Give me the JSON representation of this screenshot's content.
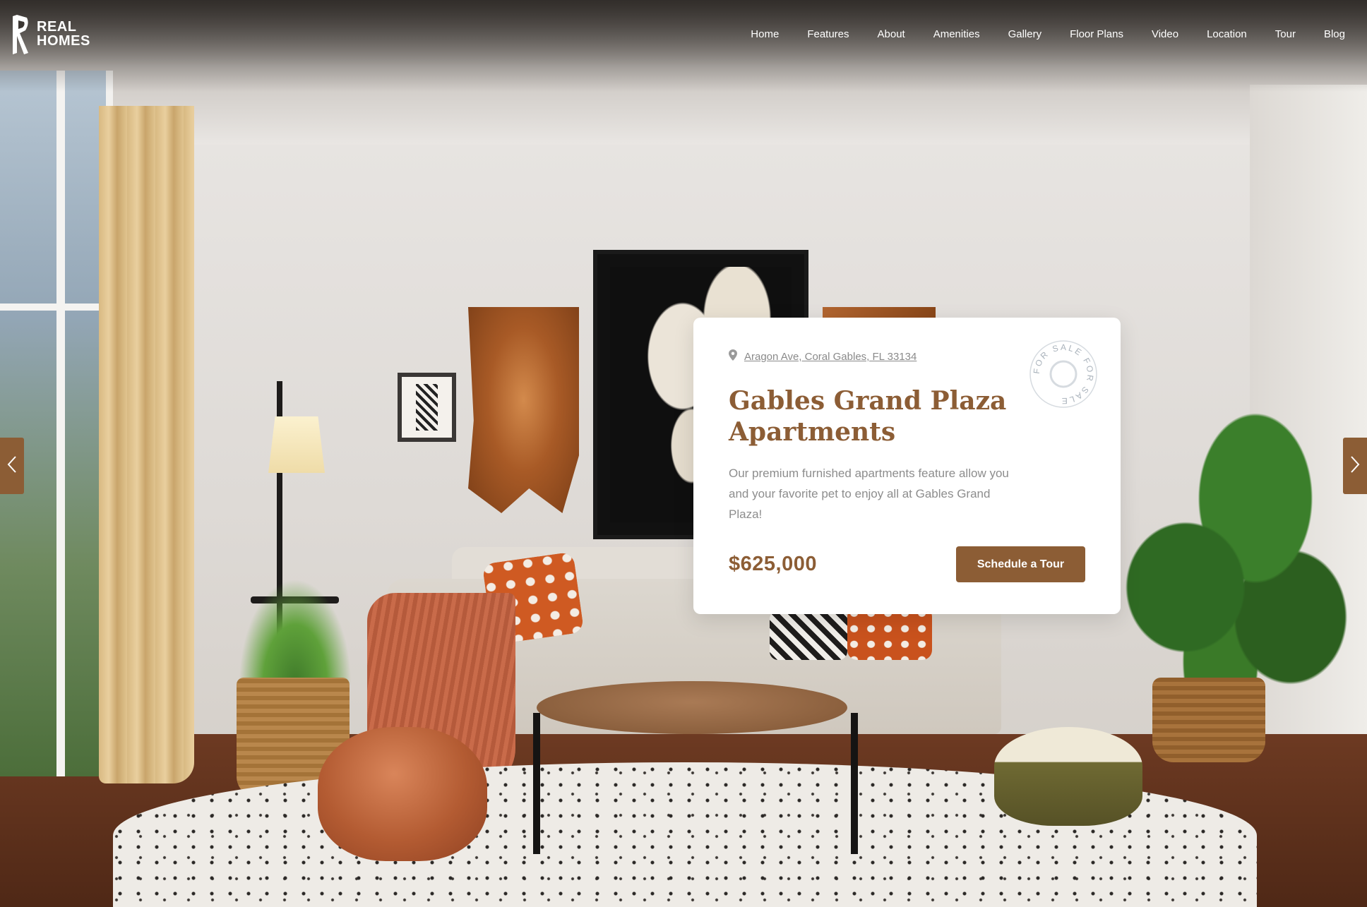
{
  "brand": {
    "line1": "REAL",
    "line2": "HOMES",
    "icon": "logo-icon"
  },
  "nav": {
    "items": [
      {
        "label": "Home"
      },
      {
        "label": "Features"
      },
      {
        "label": "About"
      },
      {
        "label": "Amenities"
      },
      {
        "label": "Gallery"
      },
      {
        "label": "Floor Plans"
      },
      {
        "label": "Video"
      },
      {
        "label": "Location"
      },
      {
        "label": "Tour"
      },
      {
        "label": "Blog"
      }
    ]
  },
  "slider": {
    "prev_icon": "chevron-left-icon",
    "next_icon": "chevron-right-icon"
  },
  "property": {
    "address": "Aragon Ave, Coral Gables, FL 33134",
    "address_icon": "map-pin-icon",
    "title": "Gables Grand Plaza Apartments",
    "description": "Our premium furnished apartments feature allow you and your favorite pet to enjoy all at Gables Grand Plaza!",
    "price": "$625,000",
    "cta_label": "Schedule a Tour",
    "badge_text": "FOR SALE FOR SALE"
  },
  "colors": {
    "accent": "#8c5d35",
    "text_muted": "#8d8d8d",
    "card_bg": "#ffffff"
  }
}
